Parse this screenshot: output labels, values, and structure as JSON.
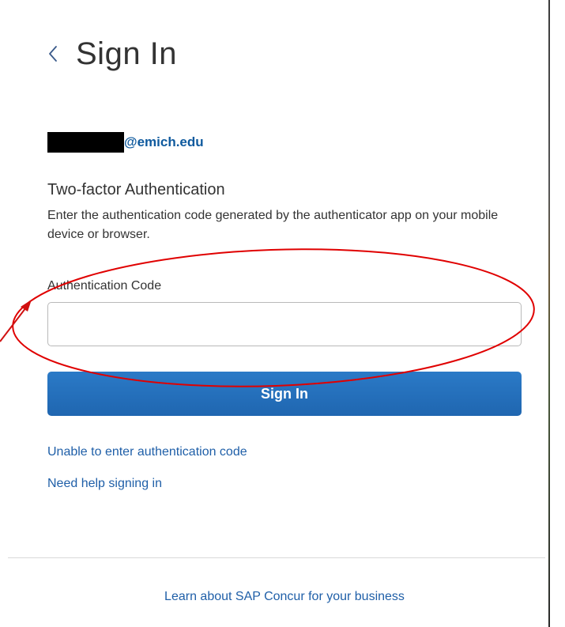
{
  "header": {
    "back_icon": "chevron-left-icon",
    "title": "Sign In"
  },
  "account": {
    "email_domain": "@emich.edu"
  },
  "two_factor": {
    "title": "Two-factor Authentication",
    "description": "Enter the authentication code generated by the authenticator app on your mobile device or browser."
  },
  "form": {
    "code_label": "Authentication Code",
    "code_value": "",
    "code_placeholder": "",
    "submit_label": "Sign In"
  },
  "links": {
    "unable": "Unable to enter authentication code",
    "help": "Need help signing in"
  },
  "footer": {
    "learn_more": "Learn about SAP Concur for your business"
  },
  "colors": {
    "primary_button": "#1f66b0",
    "link": "#1f5fa8",
    "annotation": "#e00000"
  }
}
